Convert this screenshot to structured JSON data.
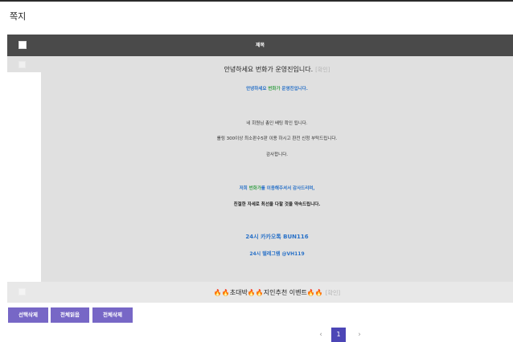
{
  "page": {
    "title": "쪽지"
  },
  "table": {
    "header": {
      "subject_col": "제목"
    }
  },
  "messages": [
    {
      "subject": "안녕하세요 번화가 운영진입니다.",
      "status": "[확인]",
      "body": {
        "greeting_1": "안녕하세요 ",
        "greeting_brand": "번화가",
        "greeting_2": " 운영진입니다.",
        "line_1": "네 회원님 총인 배팅 확인 됩니다.",
        "line_2": "롤링 300이상 최소판수5판 이용 하시고 환전 신청 부탁드립니다.",
        "line_3": "감사합니다.",
        "thanks_1": "저희 ",
        "thanks_brand": "번화가",
        "thanks_2": "를 이용해주셔서 감사드리며,",
        "promise": "친절한 자세로 최선을 다할 것을 약속드립니다.",
        "kakao": "24시 카카오톡 BUN116",
        "telegram": "24시 텔레그램 @VH119"
      }
    },
    {
      "subject_prefix": "🔥🔥",
      "subject_a": "초대박",
      "subject_mid": "🔥🔥",
      "subject_b": "지인추천 이벤트",
      "subject_suffix": "🔥🔥",
      "status": "[확인]"
    }
  ],
  "actions": {
    "delete_selected": "선택삭제",
    "read_all": "전체읽음",
    "delete_all": "전체삭제"
  },
  "pagination": {
    "prev": "‹",
    "current": "1",
    "next": "›"
  },
  "colors": {
    "header_bg": "#4a4a4a",
    "button": "#7767c6",
    "page_active": "#4c46b6",
    "blue_text": "#2a72c8",
    "green_text": "#3aa04a"
  }
}
